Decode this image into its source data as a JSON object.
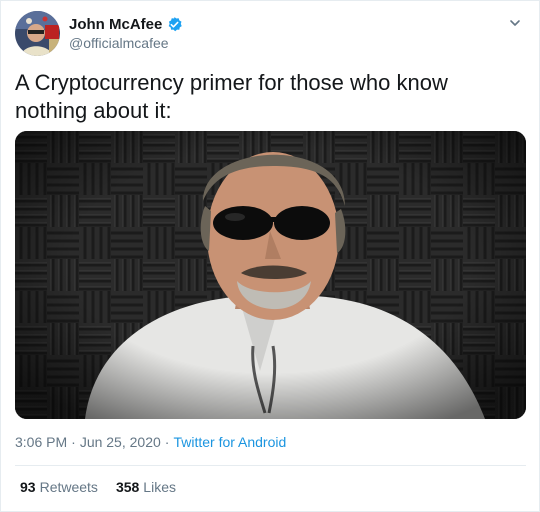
{
  "author": {
    "display_name": "John McAfee",
    "handle": "@officialmcafee",
    "verified": true
  },
  "tweet": {
    "text": "A Cryptocurrency primer for those who know nothing about it:",
    "time": "3:06 PM",
    "date": "Jun 25, 2020",
    "separator": "·",
    "source": "Twitter for Android"
  },
  "stats": {
    "retweets_count": "93",
    "retweets_label": "Retweets",
    "likes_count": "358",
    "likes_label": "Likes"
  },
  "icons": {
    "verified": "verified-badge-icon",
    "caret": "chevron-down-icon"
  },
  "colors": {
    "accent": "#1b95e0",
    "verified": "#1da1f2",
    "secondary_text": "#657786",
    "primary_text": "#14171a",
    "border": "#e6ecf0"
  }
}
